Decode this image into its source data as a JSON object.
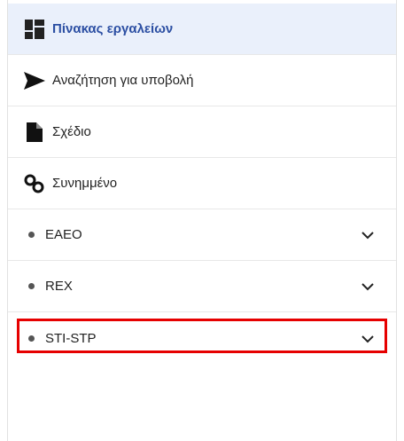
{
  "sidebar": {
    "items": [
      {
        "label": "Πίνακας εργαλείων",
        "icon": "dashboard-icon",
        "active": true
      },
      {
        "label": "Αναζήτηση για υποβολή",
        "icon": "send-icon"
      },
      {
        "label": "Σχέδιο",
        "icon": "document-icon"
      },
      {
        "label": "Συνημμένο",
        "icon": "link-icon"
      }
    ],
    "groups": [
      {
        "label": "EAEO",
        "icon": "chevron-down-icon"
      },
      {
        "label": "REX",
        "icon": "chevron-down-icon"
      },
      {
        "label": "STI-STP",
        "icon": "chevron-down-icon",
        "highlighted": true
      }
    ]
  },
  "colors": {
    "active_text": "#2c4fa3",
    "active_bg": "#eaf0fb",
    "highlight_border": "#e60000"
  }
}
